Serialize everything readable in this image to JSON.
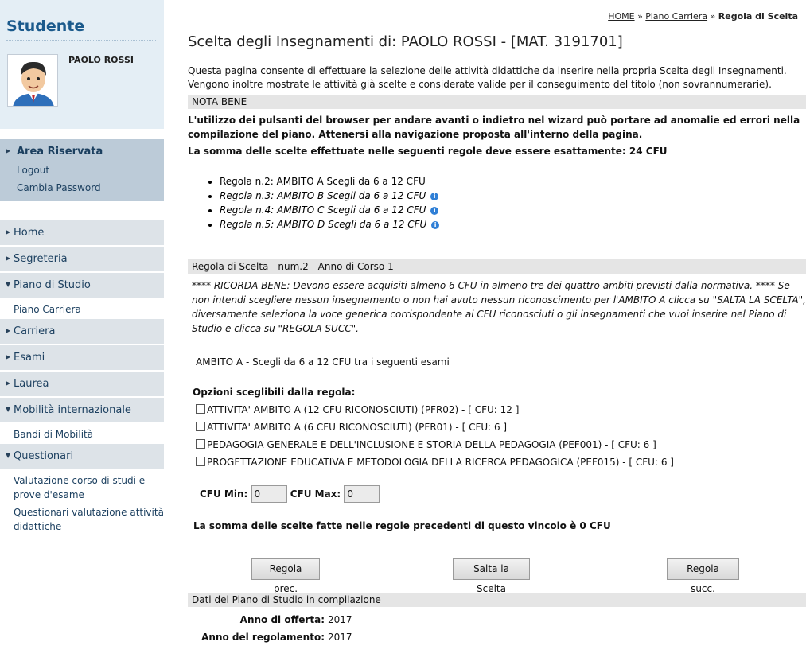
{
  "sidebar": {
    "title": "Studente",
    "user_name": "PAOLO ROSSI",
    "area": {
      "title": "Area Riservata",
      "links": [
        "Logout",
        "Cambia Password"
      ]
    },
    "menu": {
      "home": "Home",
      "segreteria": "Segreteria",
      "piano_studio": "Piano di Studio",
      "piano_carriera": "Piano Carriera",
      "carriera": "Carriera",
      "esami": "Esami",
      "laurea": "Laurea",
      "mobilita": "Mobilità internazionale",
      "bandi": "Bandi di Mobilità",
      "questionari": "Questionari",
      "valutazione": "Valutazione corso di studi e prove d'esame",
      "questionari_valutazione": "Questionari valutazione attività didattiche"
    }
  },
  "breadcrumb": {
    "home": "HOME",
    "sep1": "»",
    "piano": "Piano Carriera",
    "sep2": "»",
    "current": "Regola di Scelta"
  },
  "page_title": "Scelta degli Insegnamenti di: PAOLO ROSSI - [MAT. 3191701]",
  "intro": "Questa pagina consente di effettuare la selezione delle attività didattiche da inserire nella propria Scelta degli Insegnamenti. Vengono inoltre mostrate le attività già scelte e considerate valide per il conseguimento del titolo (non sovrannumerarie).",
  "nota_bene": {
    "header": "NOTA BENE",
    "text": "L'utilizzo dei pulsanti del browser per andare avanti o indietro nel wizard può portare ad anomalie ed errori nella compilazione del piano. Attenersi alla navigazione proposta all'interno della pagina.",
    "somma": "La somma delle scelte effettuate nelle seguenti regole deve essere esattamente: 24 CFU"
  },
  "rules": [
    "Regola n.2: AMBITO A Scegli da 6 a 12 CFU",
    "Regola n.3: AMBITO B Scegli da 6 a 12 CFU",
    "Regola n.4: AMBITO C Scegli da 6 a 12 CFU",
    "Regola n.5: AMBITO D Scegli da 6 a 12 CFU"
  ],
  "regola": {
    "header": "Regola di Scelta - num.2 - Anno di Corso 1",
    "ricorda": "**** RICORDA BENE: Devono essere acquisiti almeno 6 CFU in almeno tre dei quattro ambiti previsti dalla normativa. **** Se non intendi scegliere nessun insegnamento o non hai avuto nessun riconoscimento per l'AMBITO A clicca su \"SALTA LA SCELTA\", diversamente seleziona la voce generica corrispondente ai CFU riconosciuti o gli insegnamenti che vuoi inserire nel Piano di Studio e clicca su \"REGOLA SUCC\".",
    "ambito_desc": "AMBITO A - Scegli da 6 a 12 CFU tra i seguenti esami",
    "opzioni_title": "Opzioni sceglibili dalla regola:",
    "options": [
      "ATTIVITA' AMBITO A (12 CFU RICONOSCIUTI) (PFR02) - [ CFU: 12 ]",
      "ATTIVITA' AMBITO A (6 CFU RICONOSCIUTI) (PFR01) - [ CFU: 6 ]",
      "PEDAGOGIA GENERALE E DELL'INCLUSIONE E STORIA DELLA PEDAGOGIA (PEF001) - [ CFU: 6 ]",
      "PROGETTAZIONE EDUCATIVA E METODOLOGIA DELLA RICERCA PEDAGOGICA (PEF015) - [ CFU: 6 ]"
    ],
    "cfu_min_label": "CFU Min:",
    "cfu_min_value": "0",
    "cfu_max_label": "CFU Max:",
    "cfu_max_value": "0",
    "somma_precedenti": "La somma delle scelte fatte nelle regole precedenti di questo vincolo è 0 CFU"
  },
  "buttons": {
    "prev": "Regola prec.",
    "skip": "Salta la Scelta",
    "next": "Regola succ."
  },
  "dati": {
    "header": "Dati del Piano di Studio in compilazione",
    "anno_offerta_label": "Anno di offerta:",
    "anno_offerta": "2017",
    "anno_regolamento_label": "Anno del regolamento:",
    "anno_regolamento": "2017"
  }
}
